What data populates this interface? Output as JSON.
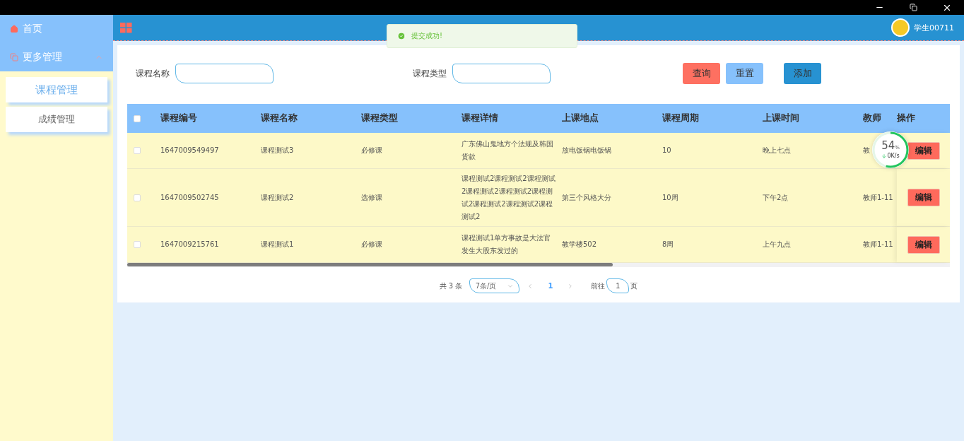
{
  "sidebar": {
    "items": [
      {
        "label": "首页",
        "kind": "link"
      },
      {
        "label": "更多管理",
        "kind": "group",
        "expanded": true,
        "children": [
          {
            "label": "课程管理",
            "selected": true
          },
          {
            "label": "成绩管理",
            "selected": false
          }
        ]
      }
    ]
  },
  "topbar": {
    "user": "学生00711"
  },
  "toast": {
    "message": "提交成功!"
  },
  "filters": [
    {
      "label": "课程名称"
    },
    {
      "label": "课程类型"
    }
  ],
  "buttons": [
    {
      "label": "查询",
      "kind": "danger"
    },
    {
      "label": "重置",
      "kind": "light"
    },
    {
      "label": "添加",
      "kind": "primary"
    }
  ],
  "table": {
    "header_checked": false,
    "columns": [
      "课程编号",
      "课程名称",
      "课程类型",
      "课程详情",
      "上课地点",
      "课程周期",
      "上课时间",
      "教师"
    ],
    "action_column": "操作",
    "rows": [
      {
        "checked": false,
        "cells": [
          "1647009549497",
          "课程测试3",
          "必修课",
          "广东佛山鬼地方个法规及韩国货款",
          "放电饭锅电饭锅",
          "10",
          "晚上七点",
          "教"
        ],
        "action": "编辑"
      },
      {
        "checked": false,
        "cells": [
          "1647009502745",
          "课程测试2",
          "选修课",
          "课程测试2课程测试2课程测试2课程测试2课程测试2课程测试2课程测试2课程测试2课程测试2",
          "第三个风格大分",
          "10周",
          "下午2点",
          "教师1-11"
        ],
        "action": "编辑"
      },
      {
        "checked": false,
        "cells": [
          "1647009215761",
          "课程测试1",
          "必修课",
          "课程测试1单方事故是大法官发生大股东发过的",
          "教学楼502",
          "8周",
          "上午九点",
          "教师1-11"
        ],
        "action": "编辑"
      }
    ]
  },
  "pagination": {
    "total": "共 3 条",
    "page_size": "7条/页",
    "pages": [
      {
        "label": "1",
        "selected": true
      }
    ],
    "goto_label": "前往",
    "goto_value": "1",
    "goto_suffix": "页"
  },
  "speed_widget": {
    "percent": "54",
    "unit": "%",
    "rate": "0K/s"
  }
}
